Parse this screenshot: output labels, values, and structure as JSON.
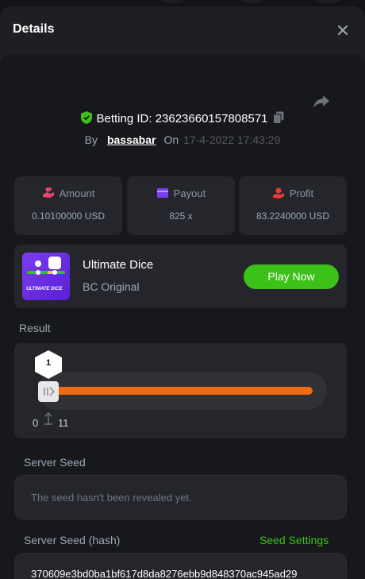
{
  "dialog": {
    "title": "Details"
  },
  "bet": {
    "id_label": "Betting ID:",
    "id_value": "23623660157808571",
    "by_label": "By",
    "user": "bassabar",
    "on_label": "On",
    "datetime": "17-4-2022 17:43:29"
  },
  "stats": {
    "amount": {
      "label": "Amount",
      "value": "0.10100000 USD",
      "icon": "money-hand-icon",
      "color": "#e8466a"
    },
    "payout": {
      "label": "Payout",
      "value": "825 x",
      "icon": "wallet-card-icon",
      "color": "#7b3df0"
    },
    "profit": {
      "label": "Profit",
      "value": "83.2240000 USD",
      "icon": "coin-hand-icon",
      "color": "#e83a3a"
    }
  },
  "game": {
    "name": "Ultimate Dice",
    "provider": "BC Original",
    "thumb_text": "ULTIMATE DICE",
    "play_label": "Play Now"
  },
  "result": {
    "label": "Result",
    "value": "1",
    "range_min": "0",
    "range_max": "11",
    "bar_color": "#f06a12"
  },
  "server_seed": {
    "label": "Server Seed",
    "text": "The seed hasn't been revealed yet."
  },
  "server_seed_hash": {
    "label": "Server Seed (hash)",
    "settings_label": "Seed Settings",
    "value": "370609e3bd0ba1bf617d8da8276ebb9d848370ac945ad29"
  },
  "colors": {
    "accent_green": "#3bc117",
    "panel": "#24262b",
    "background": "#17181b"
  }
}
